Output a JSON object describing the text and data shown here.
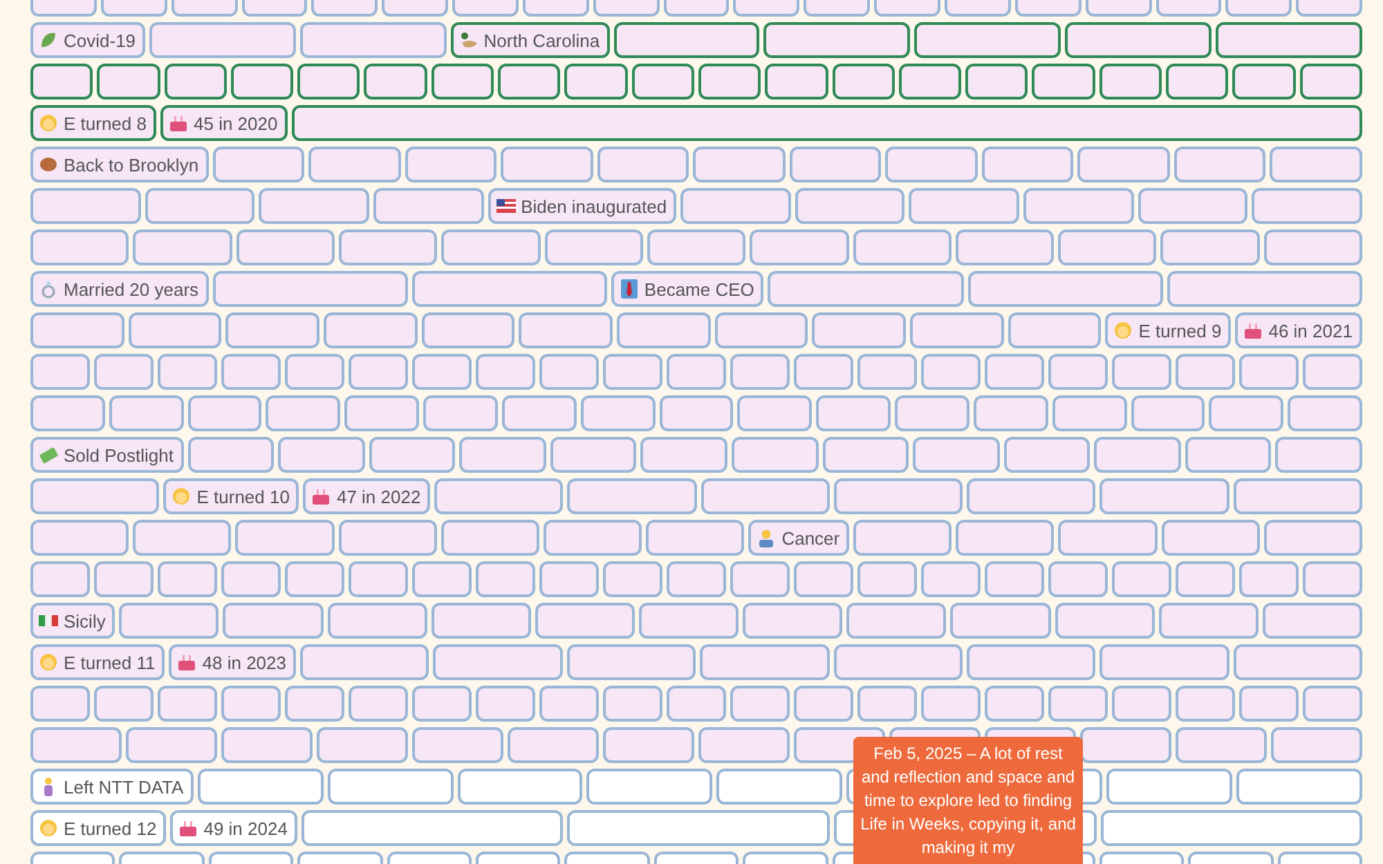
{
  "rows": [
    {
      "future": false,
      "cells": [
        {
          "highlighted": false
        },
        {
          "highlighted": false
        },
        {
          "highlighted": false
        },
        {
          "highlighted": false
        },
        {
          "highlighted": false
        },
        {
          "highlighted": false
        },
        {
          "highlighted": false
        },
        {
          "highlighted": false
        },
        {
          "highlighted": false
        },
        {
          "highlighted": false
        },
        {
          "highlighted": false
        },
        {
          "highlighted": false
        },
        {
          "highlighted": false
        },
        {
          "highlighted": false
        },
        {
          "highlighted": false
        },
        {
          "highlighted": false
        },
        {
          "highlighted": false
        },
        {
          "highlighted": false
        },
        {
          "highlighted": false
        }
      ]
    },
    {
      "future": false,
      "cells": [
        {
          "label": "Covid-19",
          "kind": "virus",
          "highlighted": false
        },
        {
          "highlighted": false
        },
        {
          "highlighted": false
        },
        {
          "label": "North Carolina",
          "kind": "duck",
          "highlighted": true
        },
        {
          "highlighted": true
        },
        {
          "highlighted": true
        },
        {
          "highlighted": true
        },
        {
          "highlighted": true
        },
        {
          "highlighted": true
        }
      ]
    },
    {
      "future": false,
      "cells": [
        {
          "highlighted": true
        },
        {
          "highlighted": true
        },
        {
          "highlighted": true
        },
        {
          "highlighted": true
        },
        {
          "highlighted": true
        },
        {
          "highlighted": true
        },
        {
          "highlighted": true
        },
        {
          "highlighted": true
        },
        {
          "highlighted": true
        },
        {
          "highlighted": true
        },
        {
          "highlighted": true
        },
        {
          "highlighted": true
        },
        {
          "highlighted": true
        },
        {
          "highlighted": true
        },
        {
          "highlighted": true
        },
        {
          "highlighted": true
        },
        {
          "highlighted": true
        },
        {
          "highlighted": true
        },
        {
          "highlighted": true
        },
        {
          "highlighted": true
        }
      ]
    },
    {
      "future": false,
      "cells": [
        {
          "label": "E turned 8",
          "kind": "child",
          "highlighted": true
        },
        {
          "label": "45 in 2020",
          "kind": "cake",
          "highlighted": true
        },
        {
          "highlighted": true
        }
      ]
    },
    {
      "future": false,
      "cells": [
        {
          "label": "Back to Brooklyn",
          "kind": "bagel",
          "highlighted": false
        },
        {
          "highlighted": false
        },
        {
          "highlighted": false
        },
        {
          "highlighted": false
        },
        {
          "highlighted": false
        },
        {
          "highlighted": false
        },
        {
          "highlighted": false
        },
        {
          "highlighted": false
        },
        {
          "highlighted": false
        },
        {
          "highlighted": false
        },
        {
          "highlighted": false
        },
        {
          "highlighted": false
        },
        {
          "highlighted": false
        }
      ]
    },
    {
      "future": false,
      "cells": [
        {
          "highlighted": false
        },
        {
          "highlighted": false
        },
        {
          "highlighted": false
        },
        {
          "highlighted": false
        },
        {
          "label": "Biden inaugurated",
          "kind": "flag-us",
          "highlighted": false
        },
        {
          "highlighted": false
        },
        {
          "highlighted": false
        },
        {
          "highlighted": false
        },
        {
          "highlighted": false
        },
        {
          "highlighted": false
        },
        {
          "highlighted": false
        }
      ]
    },
    {
      "future": false,
      "cells": [
        {
          "highlighted": false
        },
        {
          "highlighted": false
        },
        {
          "highlighted": false
        },
        {
          "highlighted": false
        },
        {
          "highlighted": false
        },
        {
          "highlighted": false
        },
        {
          "highlighted": false
        },
        {
          "highlighted": false
        },
        {
          "highlighted": false
        },
        {
          "highlighted": false
        },
        {
          "highlighted": false
        },
        {
          "highlighted": false
        },
        {
          "highlighted": false
        }
      ]
    },
    {
      "future": false,
      "cells": [
        {
          "label": "Married 20 years",
          "kind": "ring",
          "highlighted": false
        },
        {
          "highlighted": false
        },
        {
          "highlighted": false
        },
        {
          "label": "Became CEO",
          "kind": "tie",
          "highlighted": false
        },
        {
          "highlighted": false
        },
        {
          "highlighted": false
        },
        {
          "highlighted": false
        }
      ]
    },
    {
      "future": false,
      "cells": [
        {
          "highlighted": false
        },
        {
          "highlighted": false
        },
        {
          "highlighted": false
        },
        {
          "highlighted": false
        },
        {
          "highlighted": false
        },
        {
          "highlighted": false
        },
        {
          "highlighted": false
        },
        {
          "highlighted": false
        },
        {
          "highlighted": false
        },
        {
          "highlighted": false
        },
        {
          "highlighted": false
        },
        {
          "label": "E turned 9",
          "kind": "child",
          "highlighted": false
        },
        {
          "label": "46 in 2021",
          "kind": "cake",
          "highlighted": false
        }
      ]
    },
    {
      "future": false,
      "cells": [
        {
          "highlighted": false
        },
        {
          "highlighted": false
        },
        {
          "highlighted": false
        },
        {
          "highlighted": false
        },
        {
          "highlighted": false
        },
        {
          "highlighted": false
        },
        {
          "highlighted": false
        },
        {
          "highlighted": false
        },
        {
          "highlighted": false
        },
        {
          "highlighted": false
        },
        {
          "highlighted": false
        },
        {
          "highlighted": false
        },
        {
          "highlighted": false
        },
        {
          "highlighted": false
        },
        {
          "highlighted": false
        },
        {
          "highlighted": false
        },
        {
          "highlighted": false
        },
        {
          "highlighted": false
        },
        {
          "highlighted": false
        },
        {
          "highlighted": false
        },
        {
          "highlighted": false
        }
      ]
    },
    {
      "future": false,
      "cells": [
        {
          "highlighted": false
        },
        {
          "highlighted": false
        },
        {
          "highlighted": false
        },
        {
          "highlighted": false
        },
        {
          "highlighted": false
        },
        {
          "highlighted": false
        },
        {
          "highlighted": false
        },
        {
          "highlighted": false
        },
        {
          "highlighted": false
        },
        {
          "highlighted": false
        },
        {
          "highlighted": false
        },
        {
          "highlighted": false
        },
        {
          "highlighted": false
        },
        {
          "highlighted": false
        },
        {
          "highlighted": false
        },
        {
          "highlighted": false
        },
        {
          "highlighted": false
        }
      ]
    },
    {
      "future": false,
      "cells": [
        {
          "label": "Sold Postlight",
          "kind": "money",
          "highlighted": false
        },
        {
          "highlighted": false
        },
        {
          "highlighted": false
        },
        {
          "highlighted": false
        },
        {
          "highlighted": false
        },
        {
          "highlighted": false
        },
        {
          "highlighted": false
        },
        {
          "highlighted": false
        },
        {
          "highlighted": false
        },
        {
          "highlighted": false
        },
        {
          "highlighted": false
        },
        {
          "highlighted": false
        },
        {
          "highlighted": false
        },
        {
          "highlighted": false
        }
      ]
    },
    {
      "future": false,
      "cells": [
        {
          "highlighted": false
        },
        {
          "label": "E turned 10",
          "kind": "child",
          "highlighted": false
        },
        {
          "label": "47 in 2022",
          "kind": "cake",
          "highlighted": false
        },
        {
          "highlighted": false
        },
        {
          "highlighted": false
        },
        {
          "highlighted": false
        },
        {
          "highlighted": false
        },
        {
          "highlighted": false
        },
        {
          "highlighted": false
        },
        {
          "highlighted": false
        }
      ]
    },
    {
      "future": false,
      "cells": [
        {
          "highlighted": false
        },
        {
          "highlighted": false
        },
        {
          "highlighted": false
        },
        {
          "highlighted": false
        },
        {
          "highlighted": false
        },
        {
          "highlighted": false
        },
        {
          "highlighted": false
        },
        {
          "label": "Cancer",
          "kind": "patient",
          "highlighted": false
        },
        {
          "highlighted": false
        },
        {
          "highlighted": false
        },
        {
          "highlighted": false
        },
        {
          "highlighted": false
        },
        {
          "highlighted": false
        }
      ]
    },
    {
      "future": false,
      "cells": [
        {
          "highlighted": false
        },
        {
          "highlighted": false
        },
        {
          "highlighted": false
        },
        {
          "highlighted": false
        },
        {
          "highlighted": false
        },
        {
          "highlighted": false
        },
        {
          "highlighted": false
        },
        {
          "highlighted": false
        },
        {
          "highlighted": false
        },
        {
          "highlighted": false
        },
        {
          "highlighted": false
        },
        {
          "highlighted": false
        },
        {
          "highlighted": false
        },
        {
          "highlighted": false
        },
        {
          "highlighted": false
        },
        {
          "highlighted": false
        },
        {
          "highlighted": false
        },
        {
          "highlighted": false
        },
        {
          "highlighted": false
        },
        {
          "highlighted": false
        },
        {
          "highlighted": false
        }
      ]
    },
    {
      "future": false,
      "cells": [
        {
          "label": "Sicily",
          "kind": "flag-it",
          "highlighted": false
        },
        {
          "highlighted": false
        },
        {
          "highlighted": false
        },
        {
          "highlighted": false
        },
        {
          "highlighted": false
        },
        {
          "highlighted": false
        },
        {
          "highlighted": false
        },
        {
          "highlighted": false
        },
        {
          "highlighted": false
        },
        {
          "highlighted": false
        },
        {
          "highlighted": false
        },
        {
          "highlighted": false
        },
        {
          "highlighted": false
        }
      ]
    },
    {
      "future": false,
      "cells": [
        {
          "label": "E turned 11",
          "kind": "child",
          "highlighted": false
        },
        {
          "label": "48 in 2023",
          "kind": "cake",
          "highlighted": false
        },
        {
          "highlighted": false
        },
        {
          "highlighted": false
        },
        {
          "highlighted": false
        },
        {
          "highlighted": false
        },
        {
          "highlighted": false
        },
        {
          "highlighted": false
        },
        {
          "highlighted": false
        },
        {
          "highlighted": false
        }
      ]
    },
    {
      "future": false,
      "cells": [
        {
          "highlighted": false
        },
        {
          "highlighted": false
        },
        {
          "highlighted": false
        },
        {
          "highlighted": false
        },
        {
          "highlighted": false
        },
        {
          "highlighted": false
        },
        {
          "highlighted": false
        },
        {
          "highlighted": false
        },
        {
          "highlighted": false
        },
        {
          "highlighted": false
        },
        {
          "highlighted": false
        },
        {
          "highlighted": false
        },
        {
          "highlighted": false
        },
        {
          "highlighted": false
        },
        {
          "highlighted": false
        },
        {
          "highlighted": false
        },
        {
          "highlighted": false
        },
        {
          "highlighted": false
        },
        {
          "highlighted": false
        },
        {
          "highlighted": false
        },
        {
          "highlighted": false
        }
      ]
    },
    {
      "future": false,
      "cells": [
        {
          "highlighted": false
        },
        {
          "highlighted": false
        },
        {
          "highlighted": false
        },
        {
          "highlighted": false
        },
        {
          "highlighted": false
        },
        {
          "highlighted": false
        },
        {
          "highlighted": false
        },
        {
          "highlighted": false
        },
        {
          "highlighted": false
        },
        {
          "highlighted": false
        },
        {
          "highlighted": false
        },
        {
          "highlighted": false
        },
        {
          "highlighted": false
        },
        {
          "highlighted": false
        }
      ]
    },
    {
      "future": true,
      "cells": [
        {
          "label": "Left NTT DATA",
          "kind": "person",
          "highlighted": false
        },
        {
          "highlighted": false
        },
        {
          "highlighted": false
        },
        {
          "highlighted": false
        },
        {
          "highlighted": false
        },
        {
          "highlighted": false
        },
        {
          "highlighted": false
        },
        {
          "highlighted": false
        },
        {
          "highlighted": false
        },
        {
          "highlighted": false
        }
      ]
    },
    {
      "future": true,
      "cells": [
        {
          "label": "E turned 12",
          "kind": "child",
          "highlighted": false
        },
        {
          "label": "49 in 2024",
          "kind": "cake",
          "highlighted": false
        },
        {
          "highlighted": false
        },
        {
          "highlighted": false
        },
        {
          "highlighted": false
        },
        {
          "highlighted": false
        }
      ]
    },
    {
      "future": true,
      "cells": [
        {
          "highlighted": false
        },
        {
          "highlighted": false
        },
        {
          "highlighted": false
        },
        {
          "highlighted": false
        },
        {
          "highlighted": false
        },
        {
          "highlighted": false
        },
        {
          "highlighted": false
        },
        {
          "highlighted": false
        },
        {
          "highlighted": false
        },
        {
          "highlighted": false
        },
        {},
        {
          "highlighted": false
        },
        {
          "highlighted": false
        },
        {
          "highlighted": false
        },
        {
          "highlighted": false
        }
      ]
    }
  ],
  "tooltip": {
    "text": "Feb 5, 2025 – A lot of rest and reflection and space and time to explore led to finding Life in Weeks, copying it, and making it my"
  }
}
